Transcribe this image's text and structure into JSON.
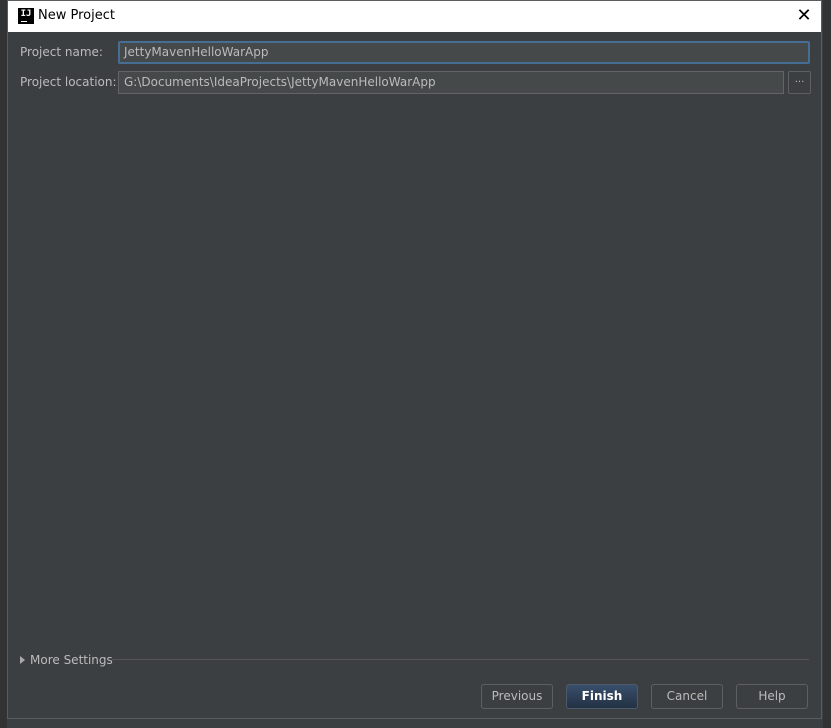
{
  "dialog": {
    "title": "New Project",
    "app_icon": "IJ"
  },
  "form": {
    "name_label": "Project name:",
    "name_value": "JettyMavenHelloWarApp",
    "location_label": "Project location:",
    "location_value": "G:\\Documents\\IdeaProjects\\JettyMavenHelloWarApp",
    "browse_label": "..."
  },
  "more_settings": "More Settings",
  "buttons": {
    "previous": "Previous",
    "finish": "Finish",
    "cancel": "Cancel",
    "help": "Help"
  },
  "colors": {
    "accent": "#466d94",
    "background": "#3c3f41",
    "default_button": "#2f4259"
  }
}
